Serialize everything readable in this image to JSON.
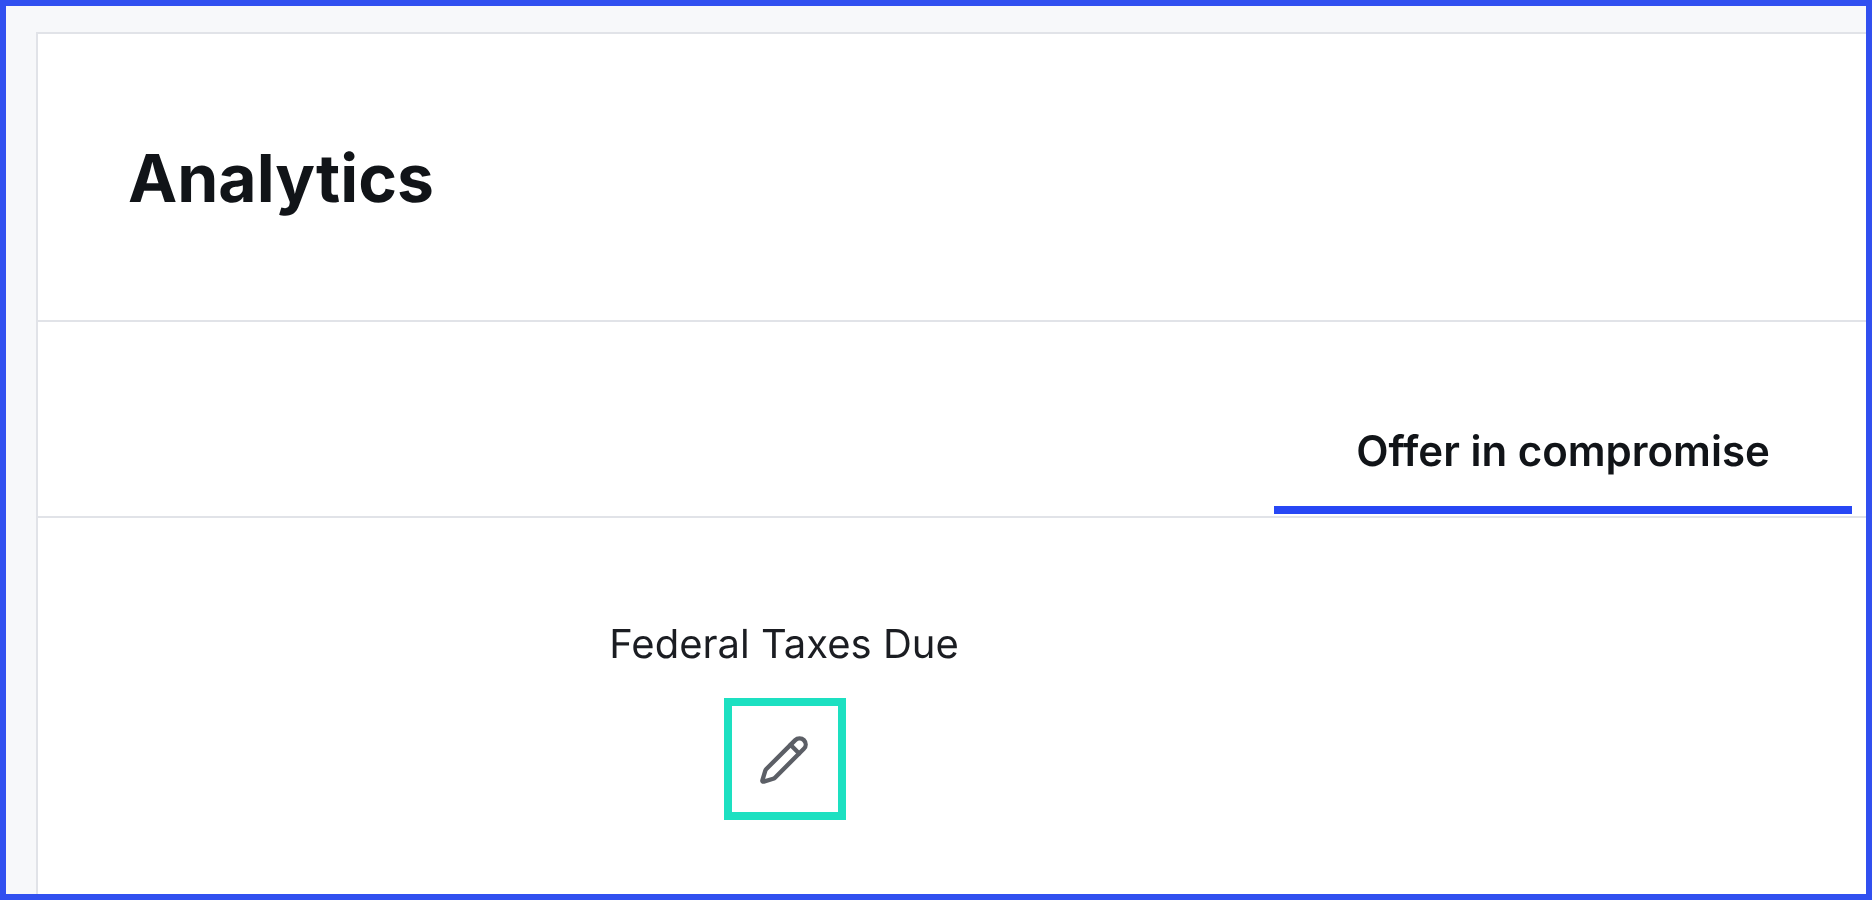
{
  "page": {
    "title": "Analytics"
  },
  "tabs": [
    {
      "label": "Offer in compromise",
      "selected": true
    }
  ],
  "field": {
    "label": "Federal Taxes Due",
    "edit_focused": true
  }
}
